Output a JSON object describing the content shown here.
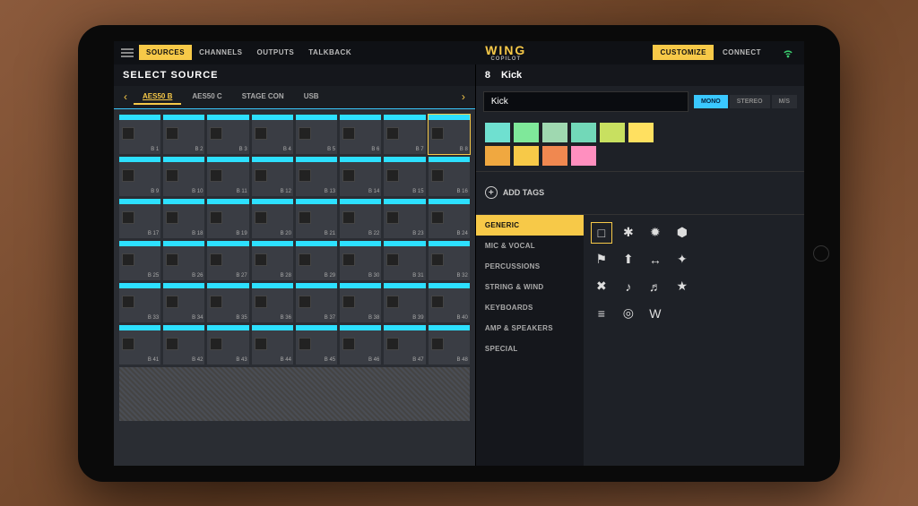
{
  "topbar": {
    "tabs": [
      "SOURCES",
      "CHANNELS",
      "OUTPUTS",
      "TALKBACK"
    ],
    "active_tab_index": 0,
    "brand": "WING",
    "brand_sub": "COPILOT",
    "right_tabs": [
      "CUSTOMIZE",
      "CONNECT"
    ],
    "right_active_index": 0
  },
  "left": {
    "title": "SELECT SOURCE",
    "source_tabs": [
      "AES50 B",
      "AES50 C",
      "STAGE CON",
      "USB"
    ],
    "source_active_index": 0,
    "slot_prefix": "B",
    "slot_count": 48,
    "selected_slot": 8
  },
  "right": {
    "channel_number": "8",
    "channel_name": "Kick",
    "name_value": "Kick",
    "modes": [
      "MONO",
      "STEREO",
      "M/S"
    ],
    "mode_active_index": 0,
    "colors": [
      "#6fe0d0",
      "#7fe89a",
      "#9fd8b0",
      "#72d8b8",
      "#c8e060",
      "#ffe060",
      "#f0a840",
      "#f7c948",
      "#f08850",
      "#ff8fbf"
    ],
    "add_tags_label": "ADD TAGS",
    "categories": [
      "GENERIC",
      "MIC & VOCAL",
      "PERCUSSIONS",
      "STRING & WIND",
      "KEYBOARDS",
      "AMP & SPEAKERS",
      "SPECIAL"
    ],
    "category_active_index": 0,
    "icons": [
      "□",
      "✱",
      "✹",
      "⬢",
      "⚑",
      "⬆",
      "↔",
      "✦",
      "✖",
      "♪",
      "♬",
      "★",
      "≡",
      "◎",
      "W"
    ]
  }
}
